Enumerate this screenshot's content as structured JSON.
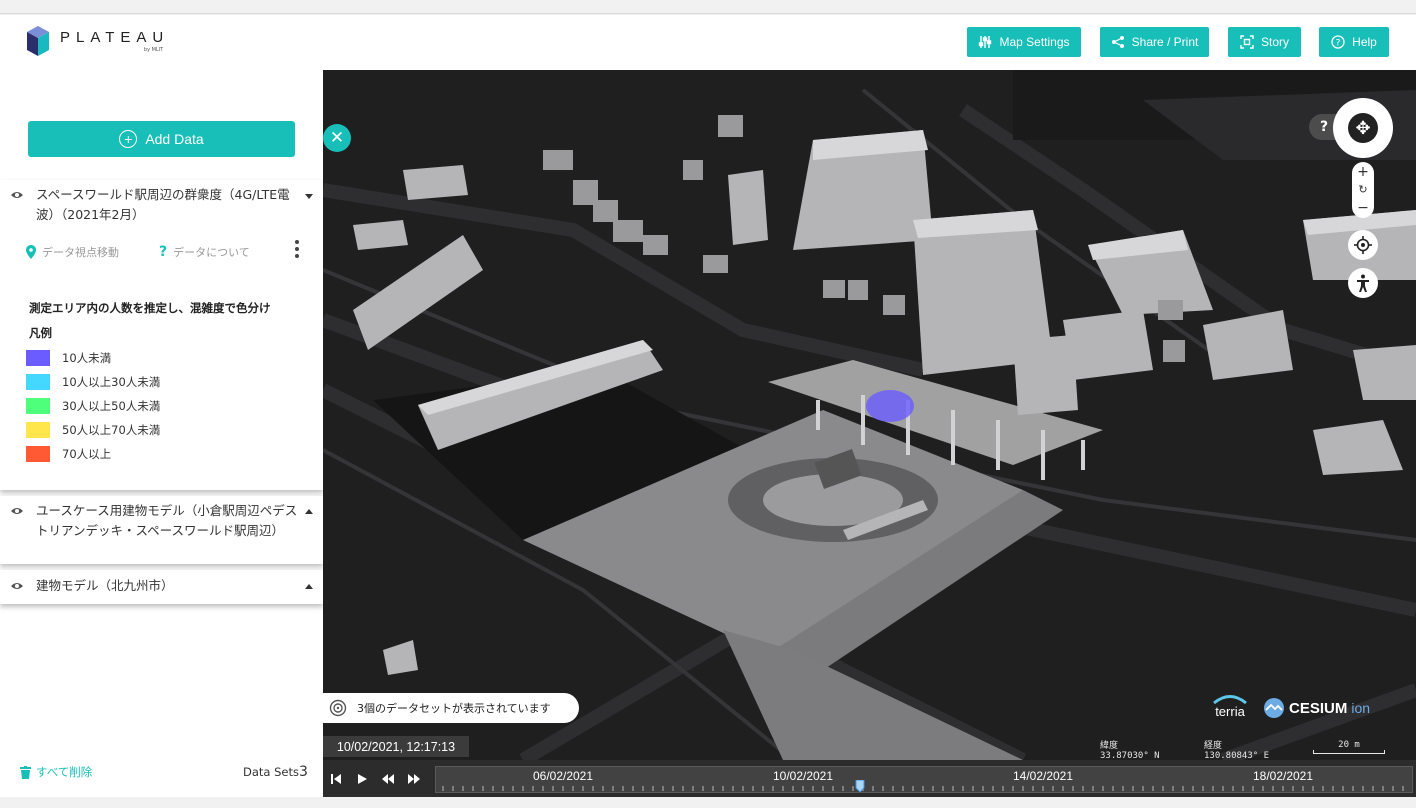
{
  "app": {
    "logo_title": "PLATEAU",
    "logo_sub": "by MLIT"
  },
  "header": {
    "buttons": [
      {
        "label": "Map Settings",
        "icon": "sliders-icon"
      },
      {
        "label": "Share / Print",
        "icon": "share-icon"
      },
      {
        "label": "Story",
        "icon": "story-icon"
      },
      {
        "label": "Help",
        "icon": "help-icon"
      }
    ]
  },
  "sidebar": {
    "add_data": "Add Data",
    "workbench": [
      {
        "title": "スペースワールド駅周辺の群衆度（4G/LTE電波）（2021年2月）",
        "expanded": true,
        "tools": {
          "move_view": "データ視点移動",
          "about": "データについて"
        },
        "legend_heading": "測定エリア内の人数を推定し、混雑度で色分け",
        "legend_label": "凡例",
        "legend": [
          {
            "label": "10人未満",
            "color": "#6b5cff"
          },
          {
            "label": "10人以上30人未満",
            "color": "#44d7ff"
          },
          {
            "label": "30人以上50人未満",
            "color": "#4dff7a"
          },
          {
            "label": "50人以上70人未満",
            "color": "#ffe64d"
          },
          {
            "label": "70人以上",
            "color": "#ff5a33"
          }
        ]
      },
      {
        "title": "ユースケース用建物モデル（小倉駅周辺ペデストリアンデッキ・スペースワールド駅周辺）",
        "expanded": false
      },
      {
        "title": "建物モデル（北九州市）",
        "expanded": false
      }
    ],
    "remove_all": "すべて削除",
    "datasets_label": "Data Sets",
    "datasets_count": "3"
  },
  "map": {
    "status_text": "3個のデータセットが表示されています",
    "clock": "10/02/2021, 12:17:13",
    "lat_label": "緯度",
    "lat_value": "33.87030° N",
    "lon_label": "経度",
    "lon_value": "130.80843° E",
    "scale": "20 m",
    "attribution_terria": "terria",
    "attribution_cesium": "CESIUM",
    "attribution_ion": "ion",
    "help_q": "?",
    "timeline": {
      "labels": [
        "06/02/2021",
        "10/02/2021",
        "14/02/2021",
        "18/02/2021"
      ]
    }
  },
  "colors": {
    "accent": "#18bfb8",
    "map_bg": "#1f1f20"
  }
}
